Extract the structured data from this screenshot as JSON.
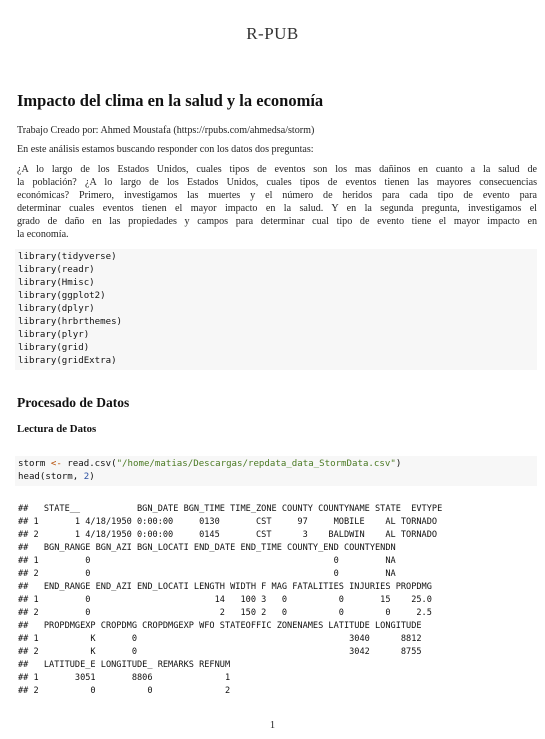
{
  "header": {
    "site": "R-PUB"
  },
  "doc": {
    "title": "Impacto del clima en la salud y la economía",
    "author_line": "Trabajo Creado por: Ahmed Moustafa (https://rpubs.com/ahmedsa/storm)",
    "intro": "En este análisis estamos buscando responder con los datos dos preguntas:",
    "questions": [
      "¿A lo largo de los Estados Unidos, cuales tipos de eventos son los mas dañinos en cuanto a la salud de",
      "la población? ¿A lo largo de los Estados Unidos, cuales tipos de eventos tienen las mayores consecuencias",
      "económicas? Primero, investigamos las muertes y el número de heridos para cada tipo de evento para",
      "determinar cuales eventos tienen el mayor impacto en la salud. Y en la segunda pregunta, investigamos el",
      "grado de daño en las propiedades y campos para determinar cual tipo de evento tiene el mayor impacto en",
      "la economía."
    ],
    "libraries": [
      "library(tidyverse)",
      "library(readr)",
      "library(Hmisc)",
      "library(ggplot2)",
      "library(dplyr)",
      "library(hrbrthemes)",
      "library(plyr)",
      "library(grid)",
      "library(gridExtra)"
    ],
    "section_title": "Procesado de Datos",
    "subsection_title": "Lectura de Datos",
    "code_read": {
      "var": "storm",
      "op": "<-",
      "fn": "read.csv(",
      "path": "\"/home/matias/Descargas/repdata_data_StormData.csv\"",
      "close": ")",
      "head_prefix": "head(storm, ",
      "head_n": "2",
      "head_suffix": ")"
    },
    "output_lines": [
      "##   STATE__           BGN_DATE BGN_TIME TIME_ZONE COUNTY COUNTYNAME STATE  EVTYPE",
      "## 1       1 4/18/1950 0:00:00     0130       CST     97     MOBILE    AL TORNADO",
      "## 2       1 4/18/1950 0:00:00     0145       CST      3    BALDWIN    AL TORNADO",
      "##   BGN_RANGE BGN_AZI BGN_LOCATI END_DATE END_TIME COUNTY_END COUNTYENDN",
      "## 1         0                                               0         NA",
      "## 2         0                                               0         NA",
      "##   END_RANGE END_AZI END_LOCATI LENGTH WIDTH F MAG FATALITIES INJURIES PROPDMG",
      "## 1         0                        14   100 3   0          0       15    25.0",
      "## 2         0                         2   150 2   0          0        0     2.5",
      "##   PROPDMGEXP CROPDMG CROPDMGEXP WFO STATEOFFIC ZONENAMES LATITUDE LONGITUDE",
      "## 1          K       0                                         3040      8812",
      "## 2          K       0                                         3042      8755",
      "##   LATITUDE_E LONGITUDE_ REMARKS REFNUM",
      "## 1       3051       8806              1",
      "## 2          0          0              2"
    ],
    "page_number": "1"
  }
}
